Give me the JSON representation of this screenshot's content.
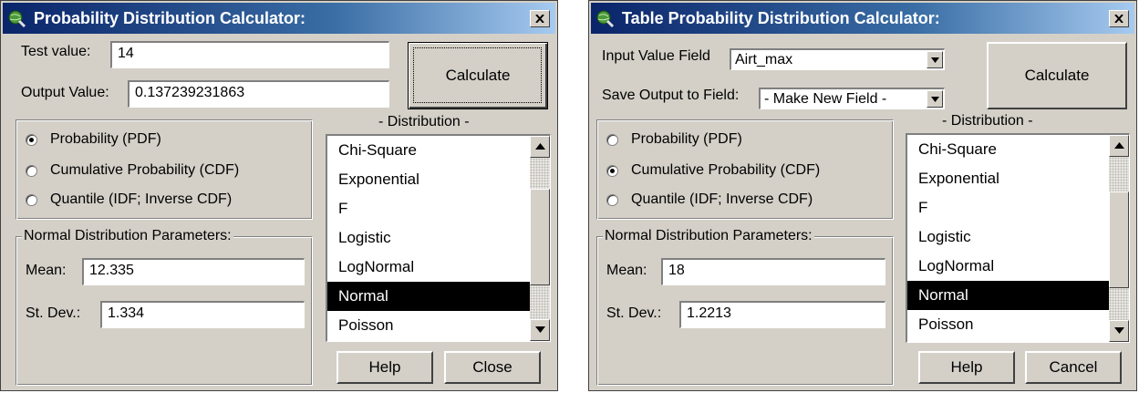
{
  "left_dialog": {
    "title": "Probability Distribution Calculator:",
    "test_value_label": "Test value:",
    "test_value": "14",
    "output_value_label": "Output Value:",
    "output_value": "0.137239231863",
    "calculate_label": "Calculate",
    "distribution_label": "- Distribution -",
    "radios": [
      {
        "label": "Probability (PDF)",
        "selected": true
      },
      {
        "label": "Cumulative Probability (CDF)",
        "selected": false
      },
      {
        "label": "Quantile (IDF; Inverse CDF)",
        "selected": false
      }
    ],
    "params_title": "Normal Distribution Parameters:",
    "mean_label": "Mean:",
    "mean_value": "12.335",
    "stdev_label": "St. Dev.:",
    "stdev_value": "1.334",
    "distributions": [
      "Chi-Square",
      "Exponential",
      "F",
      "Logistic",
      "LogNormal",
      "Normal",
      "Poisson"
    ],
    "selected_distribution": "Normal",
    "help_label": "Help",
    "close_label": "Close"
  },
  "right_dialog": {
    "title": "Table Probability Distribution Calculator:",
    "input_field_label": "Input Value Field",
    "input_field_value": "Airt_max",
    "save_output_label": "Save Output to Field:",
    "save_output_value": "- Make New Field -",
    "calculate_label": "Calculate",
    "distribution_label": "- Distribution -",
    "radios": [
      {
        "label": "Probability (PDF)",
        "selected": false
      },
      {
        "label": "Cumulative Probability (CDF)",
        "selected": true
      },
      {
        "label": "Quantile (IDF; Inverse CDF)",
        "selected": false
      }
    ],
    "params_title": "Normal Distribution Parameters:",
    "mean_label": "Mean:",
    "mean_value": "18",
    "stdev_label": "St. Dev.:",
    "stdev_value": "1.2213",
    "distributions": [
      "Chi-Square",
      "Exponential",
      "F",
      "Logistic",
      "LogNormal",
      "Normal",
      "Poisson"
    ],
    "selected_distribution": "Normal",
    "help_label": "Help",
    "cancel_label": "Cancel"
  },
  "icons": {
    "app": "globe-magnifier-icon",
    "close": "close-icon",
    "scroll_up": "scroll-up-arrow-icon",
    "scroll_down": "scroll-down-arrow-icon",
    "dropdown": "chevron-down-icon"
  }
}
